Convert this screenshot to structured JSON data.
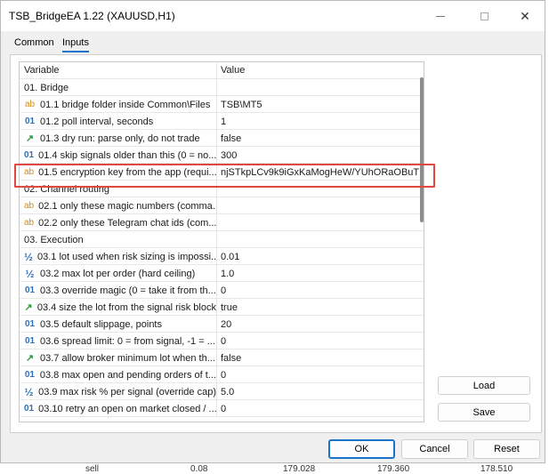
{
  "window": {
    "title": "TSB_BridgeEA 1.22 (XAUUSD,H1)",
    "close_glyph": "✕"
  },
  "tabs": [
    {
      "label": "Common"
    },
    {
      "label": "Inputs"
    }
  ],
  "grid": {
    "headers": {
      "variable": "Variable",
      "value": "Value"
    },
    "rows": [
      {
        "icon": "",
        "variable": "01. Bridge",
        "value": ""
      },
      {
        "icon": "ab",
        "variable": "01.1 bridge folder inside Common\\Files",
        "value": "TSB\\MT5"
      },
      {
        "icon": "01",
        "variable": "01.2 poll interval, seconds",
        "value": "1"
      },
      {
        "icon": "↗",
        "variable": "01.3 dry run: parse only, do not trade",
        "value": "false"
      },
      {
        "icon": "01",
        "variable": "01.4 skip signals older than this (0 = no...",
        "value": "300"
      },
      {
        "icon": "ab",
        "variable": "01.5 encryption key from the app (requi...",
        "value": "njSTkpLCv9k9iGxKaMogHeW/YUhORaOBuTI..."
      },
      {
        "icon": "",
        "variable": "02. Channel routing",
        "value": ""
      },
      {
        "icon": "ab",
        "variable": "02.1 only these magic numbers (comma...",
        "value": ""
      },
      {
        "icon": "ab",
        "variable": "02.2 only these Telegram chat ids (com...",
        "value": ""
      },
      {
        "icon": "",
        "variable": "03. Execution",
        "value": ""
      },
      {
        "icon": "½",
        "variable": "03.1 lot used when risk sizing is impossi...",
        "value": "0.01"
      },
      {
        "icon": "½",
        "variable": "03.2 max lot per order (hard ceiling)",
        "value": "1.0"
      },
      {
        "icon": "01",
        "variable": "03.3 override magic (0 = take it from th...",
        "value": "0"
      },
      {
        "icon": "↗",
        "variable": "03.4 size the lot from the signal risk block",
        "value": "true"
      },
      {
        "icon": "01",
        "variable": "03.5 default slippage, points",
        "value": "20"
      },
      {
        "icon": "01",
        "variable": "03.6 spread limit: 0 = from signal, -1 = ...",
        "value": "0"
      },
      {
        "icon": "↗",
        "variable": "03.7 allow broker minimum lot when th...",
        "value": "false"
      },
      {
        "icon": "01",
        "variable": "03.8 max open and pending orders of t...",
        "value": "0"
      },
      {
        "icon": "½",
        "variable": "03.9 max risk % per signal (override cap)",
        "value": "5.0"
      },
      {
        "icon": "01",
        "variable": "03.10 retry an open on market closed / ...",
        "value": "0"
      }
    ]
  },
  "buttons": {
    "load": "Load",
    "save": "Save",
    "ok": "OK",
    "cancel": "Cancel",
    "reset": "Reset"
  },
  "behind": {
    "type": "sell",
    "volume": "0.08",
    "price1": "179.028",
    "price2": "179.360",
    "price3": "178.510"
  },
  "colors": {
    "highlight": "#e0473f",
    "accent": "#1a73c9"
  }
}
